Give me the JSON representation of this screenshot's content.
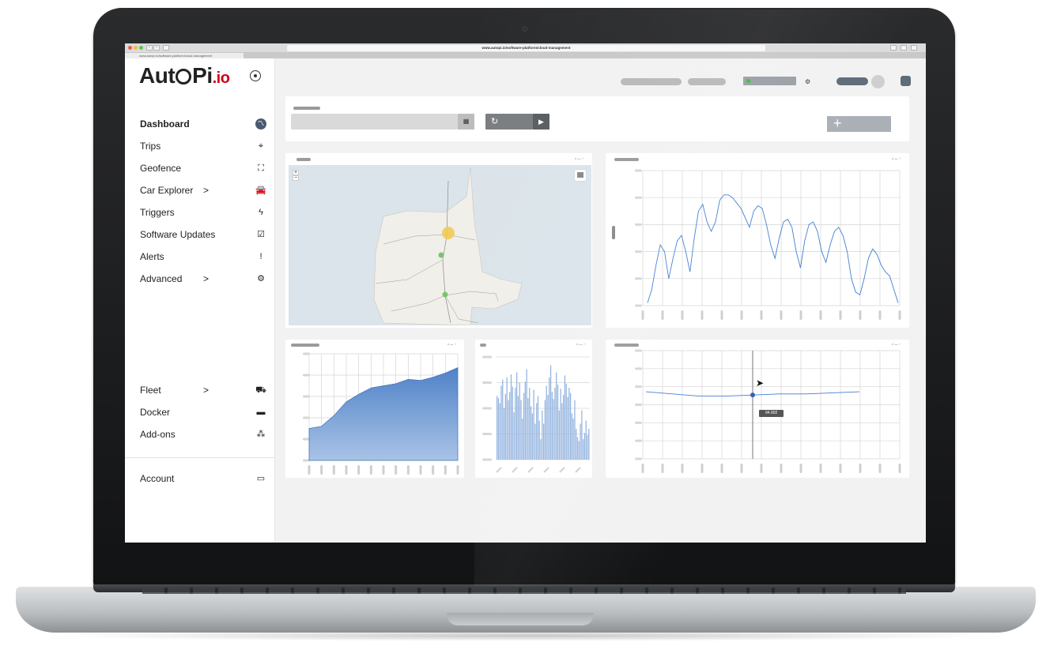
{
  "browser": {
    "url": "www.autopi.io/software-platform/cloud-management",
    "tab_title": "www.autopi.io/software-platform/cloud-management",
    "traffic_colors": [
      "#ee5b56",
      "#f6bd3b",
      "#5fc454"
    ]
  },
  "brand": {
    "name_prefix": "Aut",
    "name_mid": "Pi",
    "name_suffix": ".io",
    "accent": "#d0021b"
  },
  "sidebar": {
    "items": [
      {
        "label": "Dashboard",
        "icon": "chart-line-icon",
        "glyph": "〽",
        "active": true,
        "chevron": ""
      },
      {
        "label": "Trips",
        "icon": "map-pins-icon",
        "glyph": "⌖",
        "active": false,
        "chevron": ""
      },
      {
        "label": "Geofence",
        "icon": "geofence-icon",
        "glyph": "⛶",
        "active": false,
        "chevron": ""
      },
      {
        "label": "Car Explorer",
        "icon": "car-icon",
        "glyph": "🚘",
        "active": false,
        "chevron": ">"
      },
      {
        "label": "Triggers",
        "icon": "bolt-icon",
        "glyph": "ϟ",
        "active": false,
        "chevron": ""
      },
      {
        "label": "Software Updates",
        "icon": "checkbox-icon",
        "glyph": "☑",
        "active": false,
        "chevron": ""
      },
      {
        "label": "Alerts",
        "icon": "exclamation-icon",
        "glyph": "!",
        "active": false,
        "chevron": ""
      },
      {
        "label": "Advanced",
        "icon": "gears-icon",
        "glyph": "⚙",
        "active": false,
        "chevron": ">"
      }
    ],
    "lower_items": [
      {
        "label": "Fleet",
        "icon": "truck-icon",
        "glyph": "⛟",
        "chevron": ">"
      },
      {
        "label": "Docker",
        "icon": "box-icon",
        "glyph": "▬",
        "chevron": ""
      },
      {
        "label": "Add-ons",
        "icon": "cubes-icon",
        "glyph": "⁂",
        "chevron": ""
      }
    ],
    "account": {
      "label": "Account",
      "icon": "id-card-icon",
      "glyph": "▭"
    }
  },
  "toolbar": {
    "refresh_glyph": "↻",
    "play_glyph": "▶",
    "add_glyph": "+",
    "calendar_glyph": "▦"
  },
  "tooltip": {
    "value": "94.902"
  },
  "chart_data": [
    {
      "type": "line",
      "title": "",
      "x": [
        0,
        1,
        2,
        3,
        4,
        5,
        6,
        7,
        8,
        9,
        10,
        11,
        12,
        13,
        14,
        15,
        16,
        17,
        18,
        19,
        20,
        21,
        22,
        23,
        24,
        25,
        26,
        27,
        28,
        29,
        30,
        31,
        32,
        33,
        34,
        35,
        36,
        37,
        38,
        39,
        40,
        41,
        42,
        43,
        44,
        45,
        46,
        47,
        48,
        49,
        50,
        51,
        52,
        53,
        54,
        55,
        56,
        57,
        58,
        59
      ],
      "y": [
        2,
        12,
        30,
        45,
        40,
        20,
        35,
        48,
        52,
        40,
        25,
        50,
        70,
        75,
        62,
        55,
        62,
        78,
        82,
        82,
        80,
        76,
        72,
        65,
        58,
        70,
        74,
        72,
        60,
        45,
        35,
        50,
        62,
        64,
        58,
        40,
        28,
        48,
        60,
        62,
        55,
        40,
        32,
        45,
        55,
        58,
        52,
        40,
        20,
        10,
        8,
        20,
        35,
        42,
        38,
        30,
        25,
        22,
        12,
        2
      ],
      "ylim": [
        0,
        100
      ]
    },
    {
      "type": "area",
      "title": "",
      "x": [
        0,
        1,
        2,
        3,
        4,
        5,
        6,
        7,
        8,
        9,
        10,
        11,
        12
      ],
      "y": [
        30,
        32,
        42,
        55,
        62,
        68,
        70,
        72,
        76,
        75,
        78,
        82,
        87
      ],
      "ylim": [
        0,
        100
      ]
    },
    {
      "type": "bar",
      "title": "",
      "values": [
        62,
        60,
        55,
        72,
        78,
        50,
        64,
        80,
        58,
        66,
        83,
        71,
        46,
        70,
        85,
        62,
        75,
        58,
        40,
        65,
        76,
        88,
        60,
        70,
        52,
        45,
        68,
        35,
        55,
        62,
        38,
        20,
        48,
        35,
        58,
        72,
        63,
        80,
        92,
        66,
        59,
        70,
        85,
        73,
        48,
        69,
        55,
        63,
        82,
        74,
        61,
        70,
        65,
        45,
        40,
        58,
        30,
        22,
        18,
        35,
        48,
        20,
        26,
        38,
        24,
        30
      ],
      "ylim": [
        0,
        100
      ]
    },
    {
      "type": "line",
      "title": "",
      "x": [
        0,
        1,
        2,
        3,
        4,
        5,
        6,
        7,
        8
      ],
      "y": [
        62,
        60,
        58,
        58,
        59,
        60,
        60,
        61,
        62
      ],
      "ylim": [
        0,
        100
      ],
      "highlight_index": 4
    }
  ]
}
